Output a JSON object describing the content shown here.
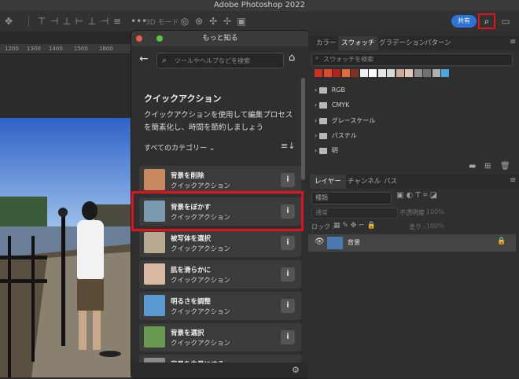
{
  "app": {
    "title": "Adobe Photoshop 2022"
  },
  "optbar": {
    "mode3d": "3D モード :",
    "share": "共有"
  },
  "ruler": {
    "ticks": [
      "1200",
      "1300",
      "1400",
      "1500",
      "1600"
    ]
  },
  "learn_panel": {
    "title": "もっと知る",
    "search_placeholder": "ツールやヘルプなどを検索",
    "section_title": "クイックアクション",
    "section_desc": "クイックアクションを使用して編集プロセスを簡素化し、時間を節約しましょう",
    "category_label": "すべてのカテゴリー",
    "cards": [
      {
        "title": "背景を削除",
        "subtitle": "クイックアクション"
      },
      {
        "title": "背景をぼかす",
        "subtitle": "クイックアクション"
      },
      {
        "title": "被写体を選択",
        "subtitle": "クイックアクション"
      },
      {
        "title": "肌を滑らかに",
        "subtitle": "クイックアクション"
      },
      {
        "title": "明るさを調整",
        "subtitle": "クイックアクション"
      },
      {
        "title": "背景を選択",
        "subtitle": "クイックアクション"
      },
      {
        "title": "背景を白黒にする",
        "subtitle": ""
      }
    ]
  },
  "swatches_panel": {
    "tabs": [
      "カラー",
      "スウォッチ",
      "グラデーション",
      "パターン"
    ],
    "search_placeholder": "スウォッチを検索",
    "colors": [
      "#c8321e",
      "#d94a2e",
      "#b02418",
      "#e06a3a",
      "#7a3320",
      "#f0f0f0",
      "#ffffff",
      "#e8e8e8",
      "#d8d8d8",
      "#cda999",
      "#e0c8b8",
      "#909090",
      "#707070",
      "#b0b0b0",
      "#4aa8e0"
    ],
    "folders": [
      "RGB",
      "CMYK",
      "グレースケール",
      "パステル",
      "明"
    ]
  },
  "layers_panel": {
    "tabs": [
      "レイヤー",
      "チャンネル",
      "パス"
    ],
    "kind": "種類",
    "blend_mode": "通常",
    "opacity_label": "不透明度 :",
    "opacity_value": "100%",
    "lock_label": "ロック :",
    "fill_label": "塗り :",
    "fill_value": "100%",
    "layer_name": "背景"
  }
}
